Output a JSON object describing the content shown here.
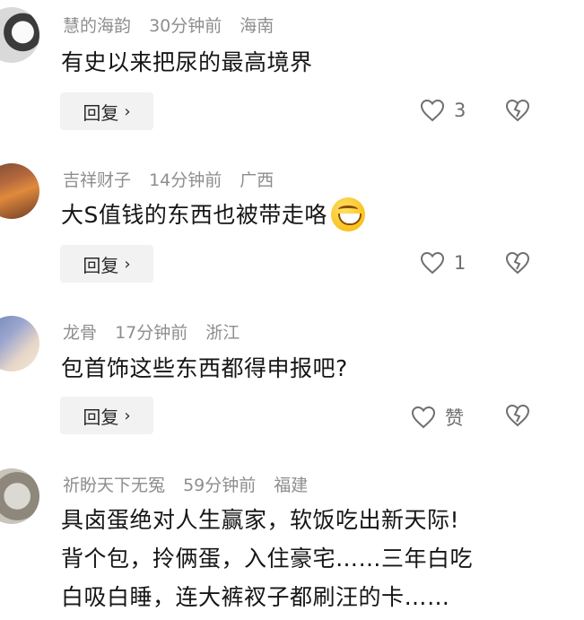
{
  "comments": [
    {
      "username": "慧的海韵",
      "time": "30分钟前",
      "location": "海南",
      "text": "有史以来把尿的最高境界",
      "reply_label": "回复",
      "like_count": "3"
    },
    {
      "username": "吉祥财子",
      "time": "14分钟前",
      "location": "广西",
      "text": "大S值钱的东西也被带走咯",
      "reply_label": "回复",
      "like_count": "1"
    },
    {
      "username": "龙骨",
      "time": "17分钟前",
      "location": "浙江",
      "text": "包首饰这些东西都得申报吧?",
      "reply_label": "回复",
      "like_count": "赞"
    },
    {
      "username": "祈盼天下无冤",
      "time": "59分钟前",
      "location": "福建",
      "text_line1": "具卤蛋绝对人生赢家，软饭吃出新天际!",
      "text_line2": "背个包，拎俩蛋，入住豪宅……三年白吃",
      "text_line3": "白吸白睡，连大裤衩子都刷汪的卡……"
    }
  ],
  "icons": {
    "like": "heart-outline-icon",
    "dislike": "broken-heart-outline-icon",
    "emoji": "laughing-emoji-icon",
    "reply_chevron": "chevron-right-icon"
  }
}
